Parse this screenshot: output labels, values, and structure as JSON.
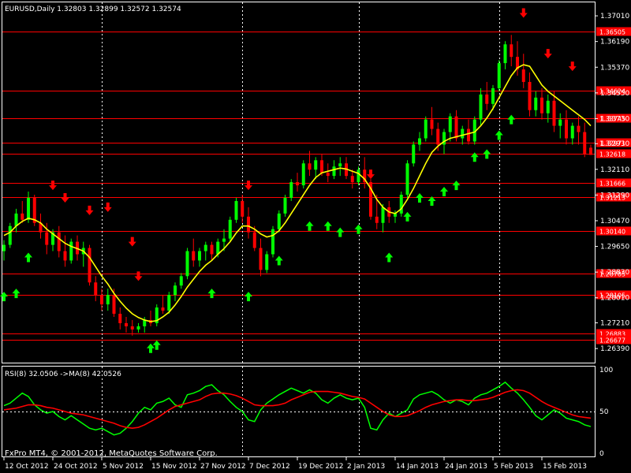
{
  "window": {
    "symbol_header": "EURUSD,Daily  1.32803 1.32899 1.32572 1.32574",
    "rsi_header": "RSI(8) 32.0506  ->MA(8) 42.0526",
    "copyright": "FxPro MT4, © 2001-2012, MetaQuotes Software Corp."
  },
  "colors": {
    "background": "#000000",
    "grid": "#ffffff",
    "bull": "#00ff00",
    "bear": "#ff0000",
    "ma": "#ffff00",
    "level_line": "#ff0000",
    "rsi": "#00ff00",
    "rsi_ma": "#ff0000",
    "up_arrow": "#00ff00",
    "down_arrow": "#ff0000"
  },
  "chart_data": [
    {
      "type": "candlestick",
      "symbol": "EURUSD",
      "timeframe": "Daily",
      "ylim": [
        1.2594,
        1.3744
      ],
      "y_ticks": [
        "1.37010",
        "1.36190",
        "1.35370",
        "1.34550",
        "1.33730",
        "1.32930",
        "1.32110",
        "1.31290",
        "1.30470",
        "1.29650",
        "1.28830",
        "1.28010",
        "1.27210",
        "1.26390"
      ],
      "x_ticks": [
        "12 Oct 2012",
        "24 Oct 2012",
        "5 Nov 2012",
        "15 Nov 2012",
        "27 Nov 2012",
        "7 Dec 2012",
        "19 Dec 2012",
        "2 Jan 2013",
        "14 Jan 2013",
        "24 Jan 2013",
        "5 Feb 2013",
        "15 Feb 2013"
      ],
      "x_tick_index": [
        0,
        8,
        16,
        24,
        32,
        40,
        48,
        56,
        64,
        72,
        80,
        88
      ],
      "vertical_grid_index": [
        16,
        39,
        58,
        81
      ],
      "levels": [
        "1.36505",
        "1.34624",
        "1.33745",
        "1.32971",
        "1.32618",
        "1.31666",
        "1.31213",
        "1.30140",
        "1.28785",
        "1.28105",
        "1.26883",
        "1.26677"
      ],
      "candles": [
        [
          1.295,
          1.2985,
          1.292,
          1.297
        ],
        [
          1.297,
          1.304,
          1.296,
          1.303
        ],
        [
          1.303,
          1.3085,
          1.301,
          1.307
        ],
        [
          1.307,
          1.311,
          1.304,
          1.305
        ],
        [
          1.305,
          1.314,
          1.304,
          1.312
        ],
        [
          1.312,
          1.313,
          1.303,
          1.304
        ],
        [
          1.304,
          1.307,
          1.299,
          1.301
        ],
        [
          1.301,
          1.304,
          1.294,
          1.297
        ],
        [
          1.297,
          1.302,
          1.295,
          1.301
        ],
        [
          1.301,
          1.303,
          1.293,
          1.295
        ],
        [
          1.295,
          1.3,
          1.29,
          1.292
        ],
        [
          1.292,
          1.299,
          1.291,
          1.298
        ],
        [
          1.298,
          1.3,
          1.292,
          1.294
        ],
        [
          1.294,
          1.298,
          1.29,
          1.296
        ],
        [
          1.296,
          1.297,
          1.284,
          1.285
        ],
        [
          1.285,
          1.287,
          1.279,
          1.281
        ],
        [
          1.281,
          1.283,
          1.276,
          1.278
        ],
        [
          1.278,
          1.283,
          1.276,
          1.281
        ],
        [
          1.281,
          1.283,
          1.274,
          1.275
        ],
        [
          1.275,
          1.277,
          1.27,
          1.272
        ],
        [
          1.272,
          1.274,
          1.269,
          1.271
        ],
        [
          1.271,
          1.273,
          1.268,
          1.27
        ],
        [
          1.27,
          1.272,
          1.269,
          1.271
        ],
        [
          1.271,
          1.274,
          1.269,
          1.273
        ],
        [
          1.273,
          1.276,
          1.271,
          1.272
        ],
        [
          1.272,
          1.278,
          1.271,
          1.277
        ],
        [
          1.277,
          1.281,
          1.275,
          1.276
        ],
        [
          1.276,
          1.282,
          1.275,
          1.281
        ],
        [
          1.281,
          1.285,
          1.279,
          1.284
        ],
        [
          1.284,
          1.288,
          1.283,
          1.287
        ],
        [
          1.287,
          1.296,
          1.286,
          1.295
        ],
        [
          1.295,
          1.299,
          1.29,
          1.292
        ],
        [
          1.292,
          1.296,
          1.29,
          1.295
        ],
        [
          1.295,
          1.298,
          1.292,
          1.297
        ],
        [
          1.297,
          1.298,
          1.292,
          1.294
        ],
        [
          1.294,
          1.299,
          1.293,
          1.298
        ],
        [
          1.298,
          1.302,
          1.295,
          1.299
        ],
        [
          1.299,
          1.306,
          1.298,
          1.305
        ],
        [
          1.305,
          1.312,
          1.304,
          1.311
        ],
        [
          1.311,
          1.313,
          1.304,
          1.306
        ],
        [
          1.306,
          1.309,
          1.299,
          1.301
        ],
        [
          1.301,
          1.303,
          1.295,
          1.296
        ],
        [
          1.296,
          1.299,
          1.287,
          1.289
        ],
        [
          1.289,
          1.295,
          1.288,
          1.294
        ],
        [
          1.294,
          1.303,
          1.293,
          1.302
        ],
        [
          1.302,
          1.308,
          1.301,
          1.307
        ],
        [
          1.307,
          1.313,
          1.306,
          1.312
        ],
        [
          1.312,
          1.318,
          1.311,
          1.317
        ],
        [
          1.317,
          1.32,
          1.314,
          1.316
        ],
        [
          1.316,
          1.324,
          1.315,
          1.323
        ],
        [
          1.323,
          1.327,
          1.319,
          1.321
        ],
        [
          1.321,
          1.325,
          1.318,
          1.324
        ],
        [
          1.324,
          1.326,
          1.319,
          1.32
        ],
        [
          1.32,
          1.323,
          1.317,
          1.319
        ],
        [
          1.319,
          1.324,
          1.318,
          1.322
        ],
        [
          1.322,
          1.325,
          1.319,
          1.323
        ],
        [
          1.323,
          1.325,
          1.318,
          1.319
        ],
        [
          1.319,
          1.321,
          1.315,
          1.317
        ],
        [
          1.317,
          1.322,
          1.316,
          1.321
        ],
        [
          1.321,
          1.325,
          1.315,
          1.317
        ],
        [
          1.317,
          1.318,
          1.305,
          1.306
        ],
        [
          1.306,
          1.313,
          1.302,
          1.304
        ],
        [
          1.304,
          1.31,
          1.301,
          1.309
        ],
        [
          1.309,
          1.311,
          1.304,
          1.306
        ],
        [
          1.306,
          1.308,
          1.304,
          1.307
        ],
        [
          1.307,
          1.314,
          1.306,
          1.313
        ],
        [
          1.313,
          1.324,
          1.312,
          1.323
        ],
        [
          1.323,
          1.33,
          1.322,
          1.329
        ],
        [
          1.329,
          1.333,
          1.327,
          1.331
        ],
        [
          1.331,
          1.338,
          1.33,
          1.337
        ],
        [
          1.337,
          1.341,
          1.332,
          1.334
        ],
        [
          1.334,
          1.336,
          1.327,
          1.329
        ],
        [
          1.329,
          1.334,
          1.326,
          1.333
        ],
        [
          1.333,
          1.339,
          1.33,
          1.338
        ],
        [
          1.338,
          1.34,
          1.33,
          1.331
        ],
        [
          1.331,
          1.335,
          1.329,
          1.334
        ],
        [
          1.334,
          1.337,
          1.329,
          1.33
        ],
        [
          1.33,
          1.338,
          1.329,
          1.337
        ],
        [
          1.337,
          1.347,
          1.335,
          1.345
        ],
        [
          1.345,
          1.349,
          1.34,
          1.342
        ],
        [
          1.342,
          1.348,
          1.34,
          1.347
        ],
        [
          1.347,
          1.356,
          1.346,
          1.355
        ],
        [
          1.355,
          1.362,
          1.353,
          1.361
        ],
        [
          1.361,
          1.364,
          1.354,
          1.357
        ],
        [
          1.357,
          1.362,
          1.351,
          1.353
        ],
        [
          1.353,
          1.358,
          1.347,
          1.349
        ],
        [
          1.349,
          1.352,
          1.338,
          1.34
        ],
        [
          1.34,
          1.346,
          1.338,
          1.344
        ],
        [
          1.344,
          1.347,
          1.337,
          1.339
        ],
        [
          1.339,
          1.345,
          1.336,
          1.343
        ],
        [
          1.343,
          1.346,
          1.333,
          1.335
        ],
        [
          1.335,
          1.339,
          1.331,
          1.337
        ],
        [
          1.337,
          1.34,
          1.329,
          1.331
        ],
        [
          1.331,
          1.336,
          1.329,
          1.335
        ],
        [
          1.335,
          1.338,
          1.329,
          1.333
        ],
        [
          1.333,
          1.336,
          1.325,
          1.326
        ],
        [
          1.328,
          1.329,
          1.3257,
          1.3257
        ]
      ],
      "ma": [
        1.3,
        1.301,
        1.303,
        1.3045,
        1.3055,
        1.305,
        1.304,
        1.302,
        1.3005,
        1.299,
        1.2975,
        1.2965,
        1.2958,
        1.295,
        1.293,
        1.29,
        1.287,
        1.2845,
        1.2815,
        1.279,
        1.2768,
        1.275,
        1.2738,
        1.273,
        1.2725,
        1.2728,
        1.274,
        1.2755,
        1.2778,
        1.2805,
        1.2835,
        1.286,
        1.2885,
        1.2905,
        1.292,
        1.294,
        1.2958,
        1.298,
        1.3008,
        1.303,
        1.303,
        1.302,
        1.3005,
        1.2995,
        1.3,
        1.3015,
        1.304,
        1.307,
        1.31,
        1.313,
        1.316,
        1.3185,
        1.32,
        1.3205,
        1.321,
        1.3215,
        1.3212,
        1.3205,
        1.3198,
        1.318,
        1.315,
        1.3115,
        1.309,
        1.3075,
        1.307,
        1.3085,
        1.3115,
        1.315,
        1.319,
        1.323,
        1.3265,
        1.3285,
        1.33,
        1.331,
        1.3315,
        1.332,
        1.3325,
        1.333,
        1.335,
        1.3375,
        1.3405,
        1.344,
        1.3475,
        1.351,
        1.3535,
        1.3545,
        1.354,
        1.351,
        1.348,
        1.346,
        1.3445,
        1.343,
        1.3415,
        1.34,
        1.3385,
        1.337,
        1.335
      ],
      "up_arrows": [
        [
          0,
          1.2805
        ],
        [
          2,
          1.2815
        ],
        [
          4,
          1.293
        ],
        [
          34,
          1.2815
        ],
        [
          40,
          1.2805
        ],
        [
          45,
          1.292
        ],
        [
          50,
          1.303
        ],
        [
          53,
          1.303
        ],
        [
          55,
          1.301
        ],
        [
          58,
          1.302
        ],
        [
          63,
          1.293
        ],
        [
          66,
          1.306
        ],
        [
          68,
          1.312
        ],
        [
          70,
          1.311
        ],
        [
          72,
          1.314
        ],
        [
          74,
          1.316
        ],
        [
          77,
          1.325
        ],
        [
          79,
          1.326
        ],
        [
          81,
          1.332
        ],
        [
          83,
          1.337
        ],
        [
          24,
          1.264
        ],
        [
          25,
          1.265
        ]
      ],
      "down_arrows": [
        [
          8,
          1.316
        ],
        [
          10,
          1.312
        ],
        [
          14,
          1.308
        ],
        [
          17,
          1.309
        ],
        [
          21,
          1.298
        ],
        [
          22,
          1.287
        ],
        [
          40,
          1.316
        ],
        [
          60,
          1.3195
        ],
        [
          85,
          1.371
        ],
        [
          89,
          1.358
        ],
        [
          93,
          1.354
        ]
      ],
      "rsi_panel": {
        "ylim": [
          0,
          100
        ],
        "y_ticks": [
          "100",
          "50",
          "0"
        ],
        "rsi": [
          57,
          60,
          66,
          72,
          68,
          58,
          52,
          48,
          50,
          44,
          40,
          45,
          40,
          35,
          30,
          28,
          30,
          26,
          22,
          24,
          30,
          38,
          48,
          55,
          52,
          60,
          62,
          66,
          58,
          55,
          70,
          72,
          75,
          80,
          82,
          75,
          70,
          62,
          55,
          50,
          40,
          38,
          52,
          60,
          65,
          70,
          74,
          78,
          75,
          72,
          76,
          72,
          64,
          60,
          66,
          70,
          66,
          64,
          66,
          55,
          30,
          28,
          40,
          48,
          44,
          48,
          52,
          65,
          70,
          72,
          74,
          70,
          64,
          60,
          64,
          62,
          58,
          66,
          70,
          72,
          76,
          80,
          85,
          78,
          72,
          64,
          55,
          45,
          40,
          46,
          52,
          48,
          42,
          40,
          38,
          34,
          32
        ],
        "rsi_ma": [
          52,
          53,
          54,
          56,
          58,
          58,
          57,
          55,
          54,
          52,
          50,
          48,
          47,
          46,
          44,
          42,
          40,
          38,
          36,
          33,
          31,
          30,
          31,
          34,
          38,
          42,
          47,
          52,
          56,
          58,
          60,
          62,
          64,
          68,
          71,
          72,
          72,
          71,
          69,
          66,
          62,
          58,
          57,
          57,
          57,
          58,
          60,
          64,
          67,
          70,
          73,
          74,
          74,
          74,
          73,
          72,
          70,
          68,
          67,
          65,
          60,
          55,
          50,
          46,
          44,
          44,
          45,
          48,
          51,
          55,
          58,
          60,
          62,
          63,
          64,
          64,
          63,
          63,
          64,
          65,
          67,
          70,
          73,
          75,
          76,
          75,
          72,
          67,
          62,
          58,
          55,
          52,
          49,
          46,
          44,
          43,
          42
        ]
      }
    }
  ]
}
